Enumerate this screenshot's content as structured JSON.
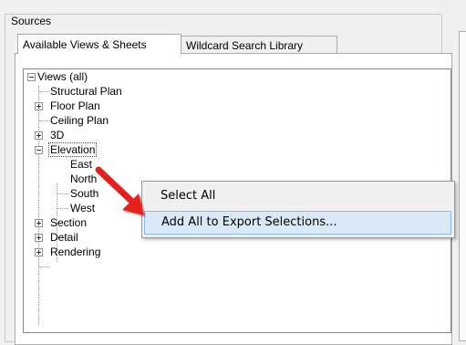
{
  "group": {
    "title": "Sources"
  },
  "tabs": [
    {
      "label": "Available Views & Sheets",
      "active": true
    },
    {
      "label": "Wildcard Search Library",
      "active": false
    }
  ],
  "tree": {
    "root": "Views (all)",
    "items": [
      "Structural Plan",
      "Floor Plan",
      "Ceiling Plan",
      "3D",
      "Elevation",
      "East",
      "North",
      "South",
      "West",
      "Section",
      "Detail",
      "Rendering"
    ]
  },
  "context_menu": {
    "items": [
      "Select All",
      "Add All to Export Selections..."
    ],
    "highlighted_index": 1
  },
  "colors": {
    "highlight_fill": "#dae9f8",
    "highlight_border": "#8ebbe8",
    "arrow": "#e8201c"
  },
  "icons": {
    "annotation_arrow": "red-arrow-icon"
  }
}
